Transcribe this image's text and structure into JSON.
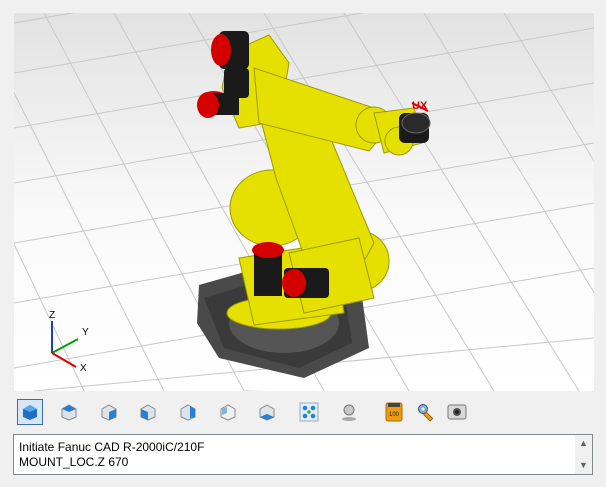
{
  "viewport": {
    "axis_labels": {
      "z": "Z",
      "y": "Y",
      "x": "X"
    },
    "tool_label": "UX"
  },
  "toolbar": {
    "buttons": [
      {
        "name": "iso-view-button",
        "icon": "iso-view-icon"
      },
      {
        "name": "top-view-button",
        "icon": "top-view-icon"
      },
      {
        "name": "front-view-button",
        "icon": "front-view-icon"
      },
      {
        "name": "left-view-button",
        "icon": "left-view-icon"
      },
      {
        "name": "right-view-button",
        "icon": "right-view-icon"
      },
      {
        "name": "back-view-button",
        "icon": "back-view-icon"
      },
      {
        "name": "bottom-view-button",
        "icon": "bottom-view-icon"
      },
      {
        "name": "fit-all-button",
        "icon": "fit-all-icon"
      },
      {
        "name": "zoom-button",
        "icon": "magnifier-icon"
      },
      {
        "name": "memory-card-button",
        "icon": "memory-card-icon",
        "label": "100"
      },
      {
        "name": "settings-button",
        "icon": "wrench-icon"
      },
      {
        "name": "screenshot-button",
        "icon": "camera-icon"
      }
    ]
  },
  "console": {
    "lines": [
      "Initiate Fanuc CAD R-2000iC/210F",
      "MOUNT_LOC.Z 670"
    ],
    "scroll_up": "▲",
    "scroll_down": "▼"
  },
  "colors": {
    "robot_yellow": "#e6e000",
    "motor_red": "#d40000",
    "motor_black": "#1a1a1a",
    "base_gray": "#4a4a4a",
    "accent_blue": "#1e64b4"
  }
}
